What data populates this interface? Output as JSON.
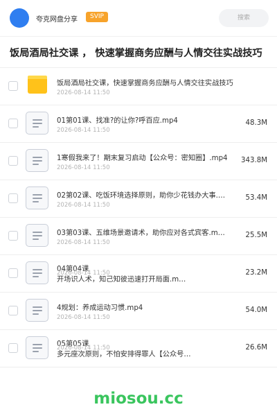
{
  "header": {
    "app_name": "夸克网盘分享",
    "badge": "SVIP",
    "search_placeholder": "搜索"
  },
  "folder_title": "饭局酒局社交课 ， 快速掌握商务应酬与人情交往实战技巧",
  "files": [
    {
      "name": "饭局酒局社交课，快速掌握商务应酬与人情交往实战技巧",
      "date": "2026-08-14 11:50",
      "size": "",
      "type": "folder"
    },
    {
      "name": "01第01课、找准?的让你?呼百应.mp4",
      "date": "2026-08-14 11:50",
      "size": "48.3M",
      "type": "doc"
    },
    {
      "name": "1寒假我来了！期末复习启动【公众号：密知圈】.mp4",
      "date": "2026-08-14 11:50",
      "size": "343.8M",
      "type": "doc"
    },
    {
      "name": "02第02课、吃饭环境选择原则，助你少花钱办大事.…",
      "date": "2026-08-14 11:50",
      "size": "53.4M",
      "type": "doc"
    },
    {
      "name": "03第03课、五维场景邀请术，助你应对各式宾客.m…",
      "date": "2026-08-14 11:50",
      "size": "25.5M",
      "type": "doc"
    },
    {
      "name": "04第04课",
      "name_line2": "开场识人术，知己知彼迅速打开局面.m…",
      "date": "2026-08-14 11:50",
      "size": "23.2M",
      "type": "doc"
    },
    {
      "name": "4规划：养成运动习惯.mp4",
      "date": "2026-08-14 11:50",
      "size": "54.0M",
      "type": "doc"
    },
    {
      "name": "05第05课",
      "name_line2": "多元座次原则，不怕安排得罪人【公众号…",
      "date": "2026-08-14 11:50",
      "size": "26.6M",
      "type": "doc"
    }
  ],
  "watermark": "miosou.cc",
  "colors": {
    "avatar": "#2f7ef0",
    "badge": "#f7a32b",
    "folder": "#ffc21a",
    "watermark": "#3ac55e"
  }
}
